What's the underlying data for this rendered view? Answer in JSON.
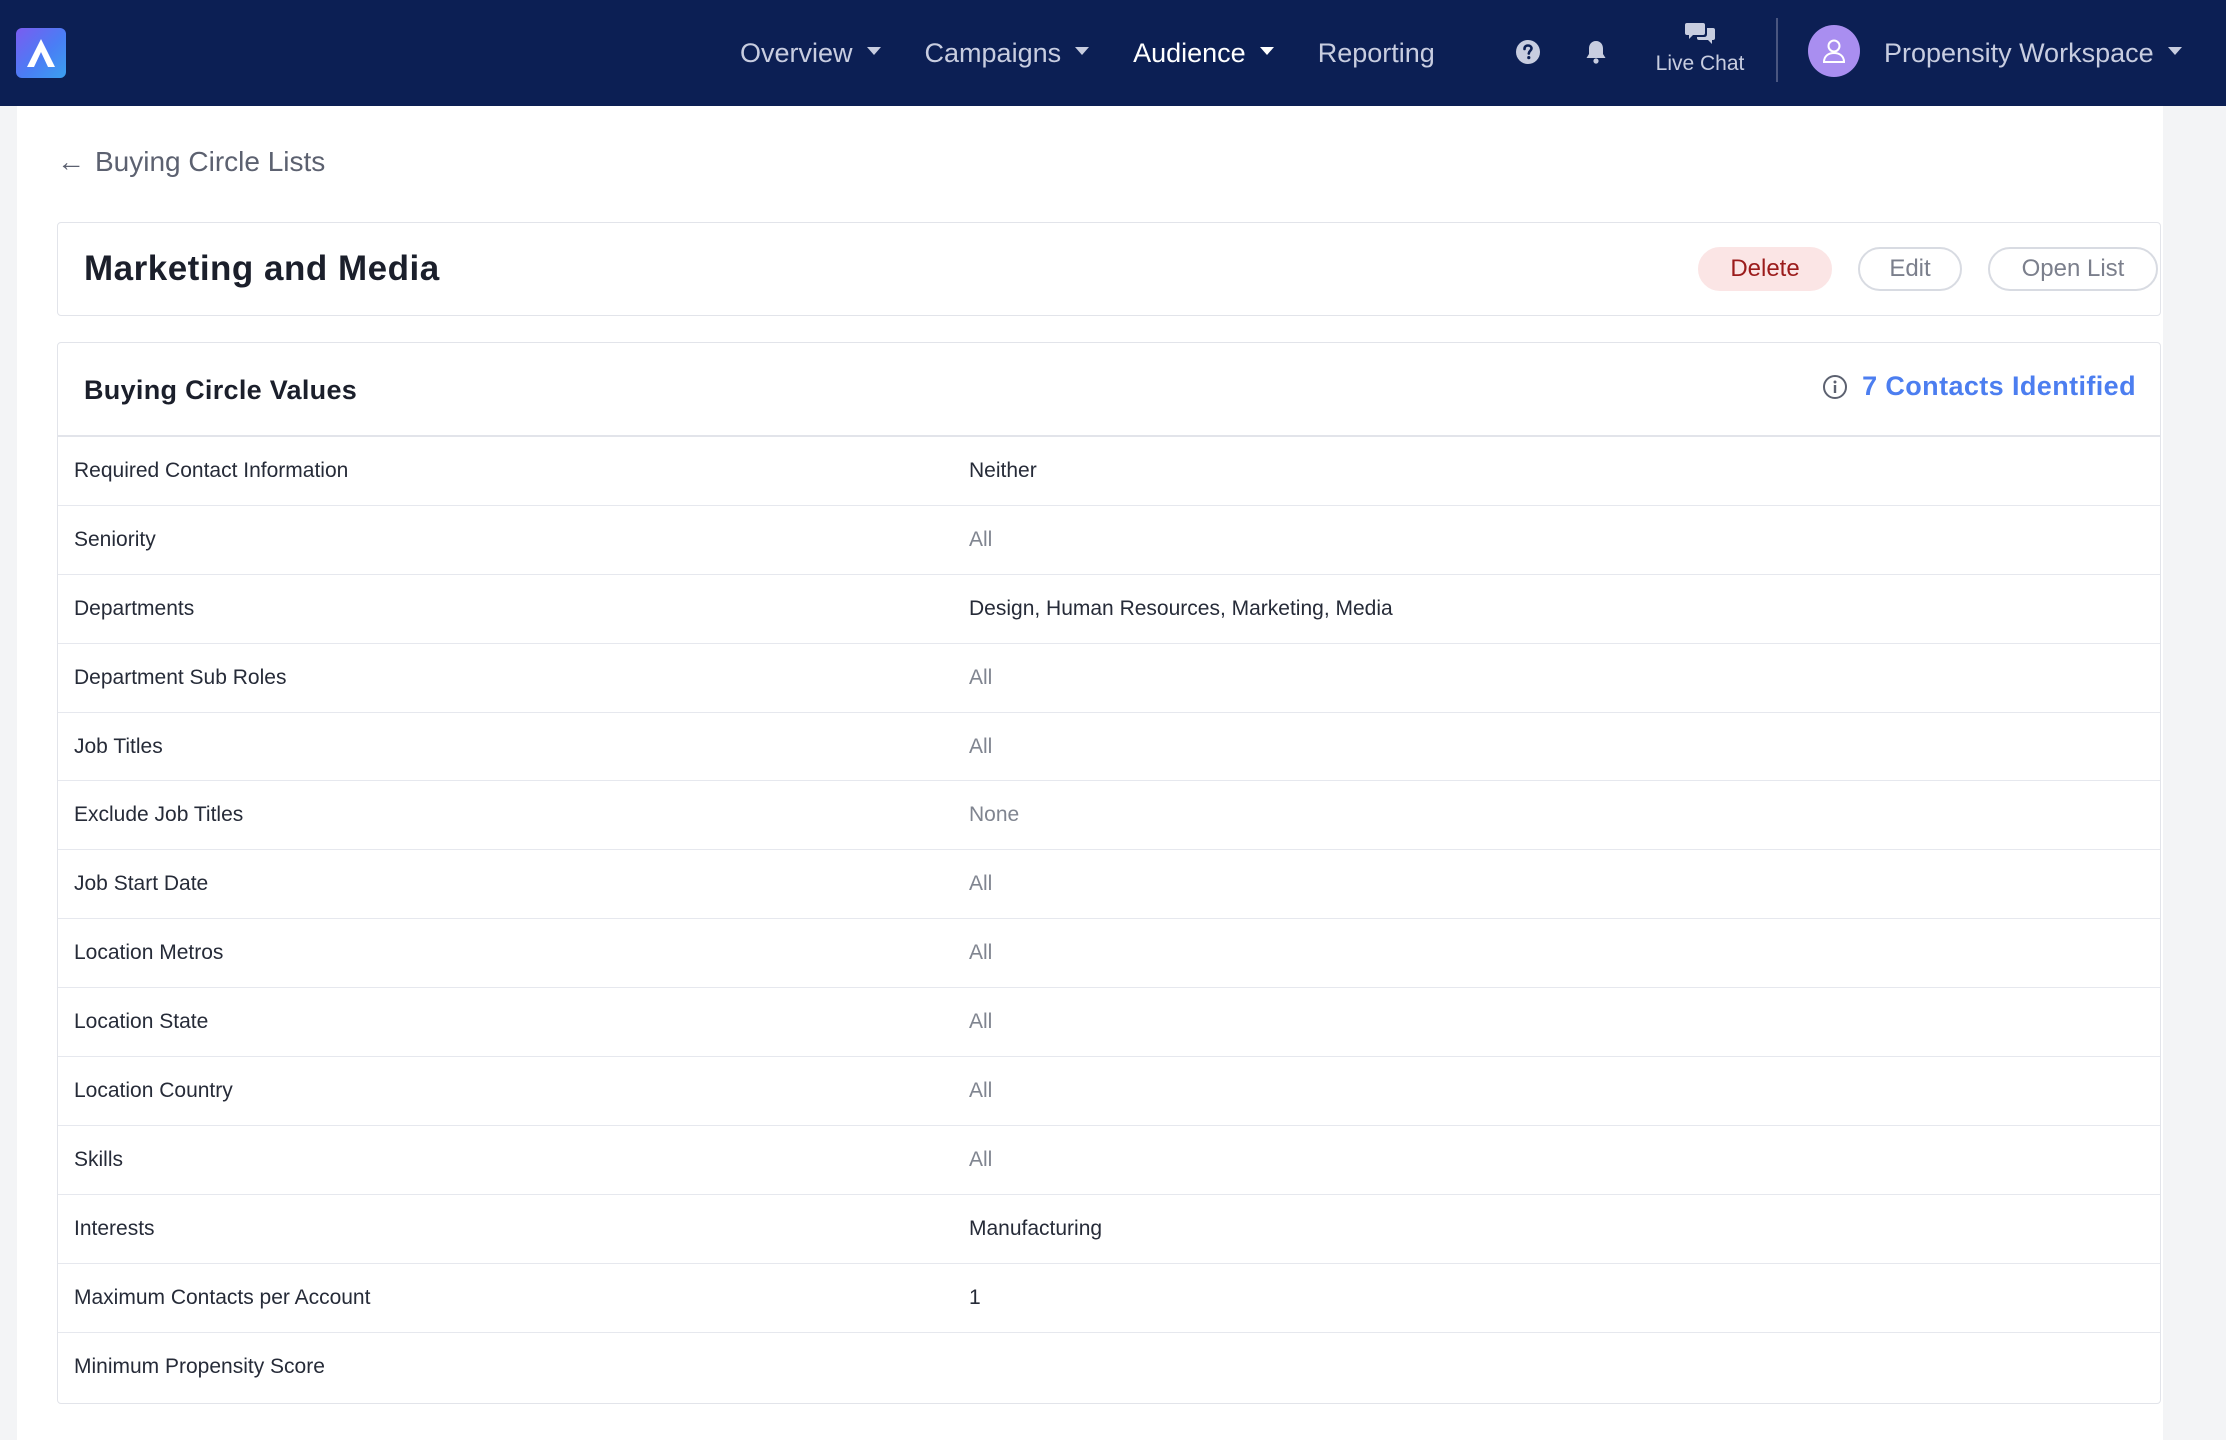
{
  "nav": {
    "items": [
      {
        "label": "Overview",
        "dropdown": true,
        "active": false
      },
      {
        "label": "Campaigns",
        "dropdown": true,
        "active": false
      },
      {
        "label": "Audience",
        "dropdown": true,
        "active": true
      },
      {
        "label": "Reporting",
        "dropdown": false,
        "active": false
      }
    ],
    "help_icon": "question-circle-icon",
    "bell_icon": "bell-icon",
    "live_chat_label": "Live Chat",
    "live_chat_icon": "chat-bubbles-icon",
    "workspace_label": "Propensity Workspace",
    "avatar_icon": "user-icon"
  },
  "back_link": {
    "label": "Buying Circle Lists"
  },
  "list": {
    "title": "Marketing and Media",
    "actions": {
      "delete": "Delete",
      "edit": "Edit",
      "open": "Open List"
    }
  },
  "values": {
    "heading": "Buying Circle Values",
    "contacts_identified": "7 Contacts Identified",
    "rows": [
      {
        "label": "Required Contact Information",
        "value": "Neither",
        "muted": false
      },
      {
        "label": "Seniority",
        "value": "All",
        "muted": true
      },
      {
        "label": "Departments",
        "value": "Design, Human Resources, Marketing, Media",
        "muted": false
      },
      {
        "label": "Department Sub Roles",
        "value": "All",
        "muted": true
      },
      {
        "label": "Job Titles",
        "value": "All",
        "muted": true
      },
      {
        "label": "Exclude Job Titles",
        "value": "None",
        "muted": true
      },
      {
        "label": "Job Start Date",
        "value": "All",
        "muted": true
      },
      {
        "label": "Location Metros",
        "value": "All",
        "muted": true
      },
      {
        "label": "Location State",
        "value": "All",
        "muted": true
      },
      {
        "label": "Location Country",
        "value": "All",
        "muted": true
      },
      {
        "label": "Skills",
        "value": "All",
        "muted": true
      },
      {
        "label": "Interests",
        "value": "Manufacturing",
        "muted": false
      },
      {
        "label": "Maximum Contacts per Account",
        "value": "1",
        "muted": false
      },
      {
        "label": "Minimum Propensity Score",
        "value": "",
        "muted": false
      }
    ]
  },
  "colors": {
    "navbar": "#0c1f54",
    "accent_link": "#4c7ef0",
    "delete_bg": "#fbe5e5",
    "delete_text": "#9b1b1b"
  }
}
